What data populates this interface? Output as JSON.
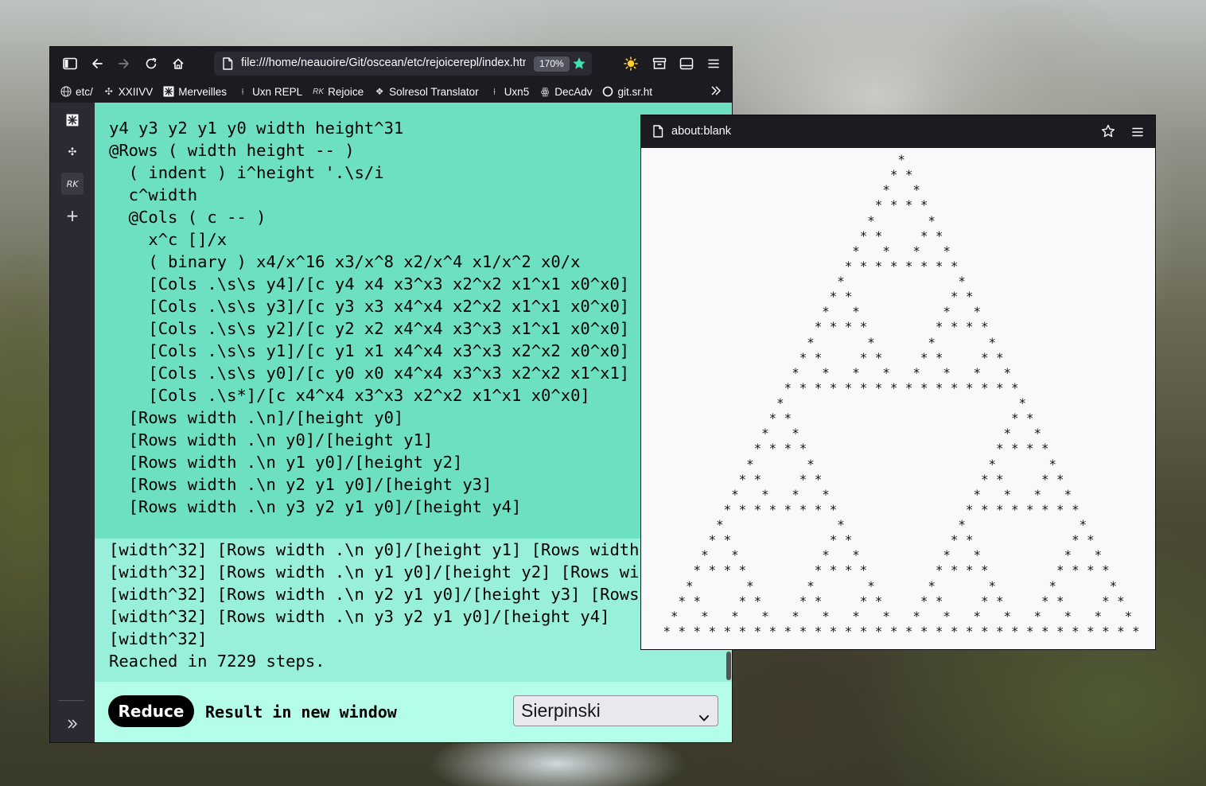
{
  "browser": {
    "url": "file:///home/neauoire/Git/oscean/etc/rejoicerepl/index.html",
    "zoom": "170%",
    "icons": [
      "sidebar-toggle-icon",
      "back-arrow-icon",
      "forward-arrow-icon",
      "reload-icon",
      "home-icon",
      "page-icon",
      "star-filled-icon",
      "sun-icon",
      "archive-icon",
      "window-icon",
      "menu-icon"
    ]
  },
  "bookmarks": [
    {
      "label": "etc/",
      "icon": "globe-icon"
    },
    {
      "label": "XXIIVV",
      "icon": "xxiivv-icon"
    },
    {
      "label": "Merveilles",
      "icon": "merveilles-icon"
    },
    {
      "label": "Uxn REPL",
      "icon": "uxn-icon"
    },
    {
      "label": "Rejoice",
      "icon": "rejoice-icon"
    },
    {
      "label": "Solresol Translator",
      "icon": "solresol-icon"
    },
    {
      "label": "Uxn5",
      "icon": "uxn5-icon"
    },
    {
      "label": "DecAdv",
      "icon": "decadv-icon"
    },
    {
      "label": "git.sr.ht",
      "icon": "circle-icon"
    }
  ],
  "sidebar": {
    "items": [
      "merveilles-icon",
      "xxiivv-icon",
      "rejoice-icon",
      "plus-icon",
      "expand-icon"
    ]
  },
  "editor": {
    "code": "y4 y3 y2 y1 y0 width height^31\n@Rows ( width height -- )\n  ( indent ) i^height '.\\s/i\n  c^width\n  @Cols ( c -- )\n    x^c []/x\n    ( binary ) x4/x^16 x3/x^8 x2/x^4 x1/x^2 x0/x\n    [Cols .\\s\\s y4]/[c y4 x4 x3^x3 x2^x2 x1^x1 x0^x0]\n    [Cols .\\s\\s y3]/[c y3 x3 x4^x4 x2^x2 x1^x1 x0^x0]\n    [Cols .\\s\\s y2]/[c y2 x2 x4^x4 x3^x3 x1^x1 x0^x0]\n    [Cols .\\s\\s y1]/[c y1 x1 x4^x4 x3^x3 x2^x2 x0^x0]\n    [Cols .\\s\\s y0]/[c y0 x0 x4^x4 x3^x3 x2^x2 x1^x1]\n    [Cols .\\s*]/[c x4^x4 x3^x3 x2^x2 x1^x1 x0^x0]\n  [Rows width .\\n]/[height y0]\n  [Rows width .\\n y0]/[height y1]\n  [Rows width .\\n y1 y0]/[height y2]\n  [Rows width .\\n y2 y1 y0]/[height y3]\n  [Rows width .\\n y3 y2 y1 y0]/[height y4]"
  },
  "output": {
    "text": "[width^32] [Rows width .\\n y0]/[height y1] [Rows width\n[width^32] [Rows width .\\n y1 y0]/[height y2] [Rows wi\n[width^32] [Rows width .\\n y2 y1 y0]/[height y3] [Rows\n[width^32] [Rows width .\\n y3 y2 y1 y0]/[height y4]\n[width^32]\nReached in 7229 steps."
  },
  "controls": {
    "reduce_label": "Reduce",
    "new_window_label": "Result in new window",
    "selected_example": "Sierpinski"
  },
  "popup": {
    "url": "about:blank",
    "output": "                                *\n                               * *\n                              *   *\n                             * * * *\n                            *       *\n                           * *     * *\n                          *   *   *   *\n                         * * * * * * * *\n                        *               *\n                       * *             * *\n                      *   *           *   *\n                     * * * *         * * * *\n                    *       *       *       *\n                   * *     * *     * *     * *\n                  *   *   *   *   *   *   *   *\n                 * * * * * * * * * * * * * * * *\n                *                               *\n               * *                             * *\n              *   *                           *   *\n             * * * *                         * * * *\n            *       *                       *       *\n           * *     * *                     * *     * *\n          *   *   *   *                   *   *   *   *\n         * * * * * * * *                 * * * * * * * *\n        *               *               *               *\n       * *             * *             * *             * *\n      *   *           *   *           *   *           *   *\n     * * * *         * * * *         * * * *         * * * *\n    *       *       *       *       *       *       *       *\n   * *     * *     * *     * *     * *     * *     * *     * *\n  *   *   *   *   *   *   *   *   *   *   *   *   *   *   *   *\n * * * * * * * * * * * * * * * * * * * * * * * * * * * * * * * *"
  },
  "colors": {
    "editor_bg": "#6ee0c2",
    "output_bg": "#98f0da",
    "controls_bg": "#b4fde8",
    "chrome_bg": "#1c1b22",
    "accent_star": "#3fe1b0",
    "sun": "#ffcf2a"
  }
}
